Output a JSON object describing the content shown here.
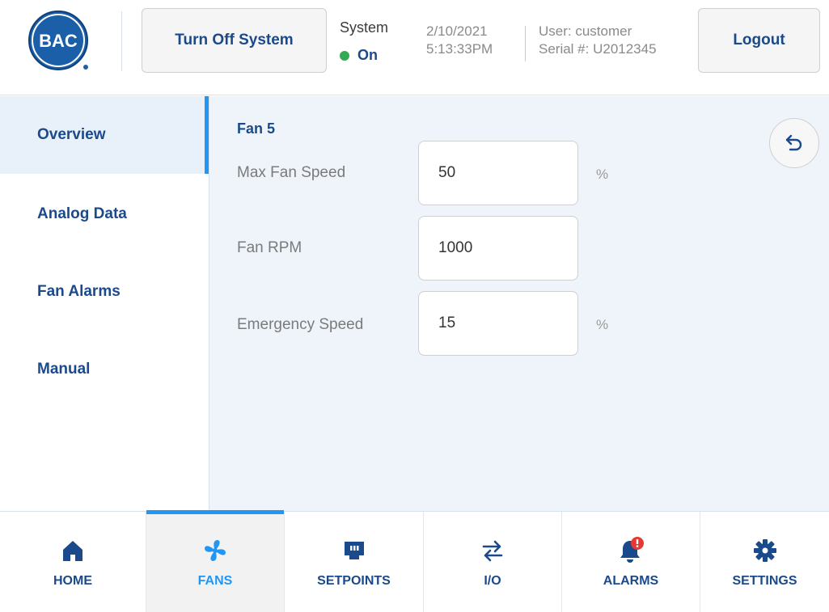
{
  "header": {
    "logo_text": "BAC",
    "turn_off_label": "Turn Off System",
    "system_label": "System",
    "system_status": "On",
    "date": "2/10/2021",
    "time": "5:13:33PM",
    "user": "User: customer",
    "serial": "Serial #: U2012345",
    "logout_label": "Logout"
  },
  "sidebar": {
    "items": [
      {
        "label": "Overview",
        "active": true
      },
      {
        "label": "Analog Data",
        "active": false
      },
      {
        "label": "Fan Alarms",
        "active": false
      },
      {
        "label": "Manual",
        "active": false
      }
    ]
  },
  "main": {
    "title": "Fan 5",
    "fields": [
      {
        "label": "Max Fan Speed",
        "value": "50",
        "unit": "%"
      },
      {
        "label": "Fan RPM",
        "value": "1000",
        "unit": ""
      },
      {
        "label": "Emergency Speed",
        "value": "15",
        "unit": "%"
      }
    ],
    "back_icon": "undo-arrow-icon"
  },
  "bottom_nav": {
    "items": [
      {
        "label": "HOME",
        "icon": "home-icon",
        "active": false
      },
      {
        "label": "FANS",
        "icon": "fan-icon",
        "active": true
      },
      {
        "label": "SETPOINTS",
        "icon": "setpoints-icon",
        "active": false
      },
      {
        "label": "I/O",
        "icon": "io-arrows-icon",
        "active": false
      },
      {
        "label": "ALARMS",
        "icon": "alarm-bell-icon",
        "active": false
      },
      {
        "label": "SETTINGS",
        "icon": "gear-icon",
        "active": false
      }
    ]
  },
  "colors": {
    "brand_blue": "#1b4a8c",
    "accent_blue": "#2196f3",
    "status_green": "#34a853",
    "alarm_red": "#e53935",
    "panel_bg": "#eef4fa"
  }
}
